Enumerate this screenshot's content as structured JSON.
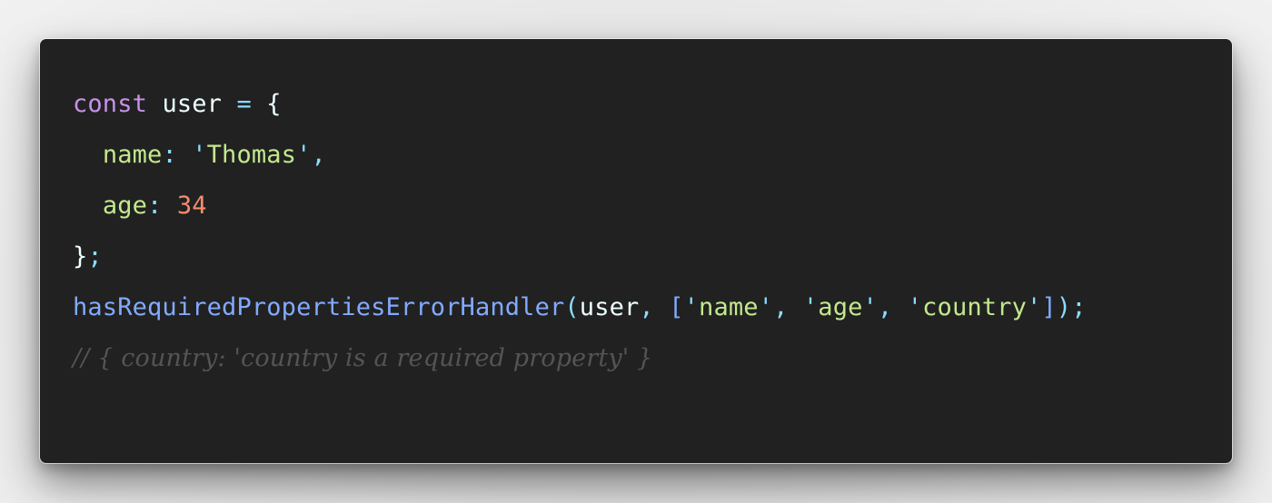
{
  "code_snippet": {
    "language": "javascript",
    "theme_colors": {
      "background": "#212121",
      "keyword": "#c792ea",
      "variable": "#eeffff",
      "operator": "#89ddff",
      "property": "#c3e88d",
      "string": "#c3e88d",
      "number": "#f78c6c",
      "function": "#82aaff",
      "comment": "#545454"
    },
    "lines": [
      {
        "tokens": {
          "keyword": "const",
          "sp1": " ",
          "name": "user",
          "sp2": " ",
          "op": "=",
          "sp3": " ",
          "brace": "{"
        }
      },
      {
        "tokens": {
          "indent": "  ",
          "prop": "name",
          "colon": ":",
          "sp": " ",
          "q1": "'",
          "str": "Thomas",
          "q2": "'",
          "comma": ","
        }
      },
      {
        "tokens": {
          "indent": "  ",
          "prop": "age",
          "colon": ":",
          "sp": " ",
          "num": "34"
        }
      },
      {
        "tokens": {
          "brace": "}",
          "semi": ";"
        }
      },
      {
        "tokens": {
          "fn": "hasRequiredPropertiesErrorHandler",
          "lparen": "(",
          "arg": "user",
          "comma1": ",",
          "sp1": " ",
          "lbracket": "[",
          "q1": "'",
          "s1": "name",
          "q2": "'",
          "comma2": ",",
          "sp2": " ",
          "q3": "'",
          "s2": "age",
          "q4": "'",
          "comma3": ",",
          "sp3": " ",
          "q5": "'",
          "s3": "country",
          "q6": "'",
          "rbracket": "]",
          "rparen": ")",
          "semi": ";"
        }
      },
      {
        "tokens": {
          "comment": "// { country: 'country is a required property' }"
        }
      }
    ]
  }
}
